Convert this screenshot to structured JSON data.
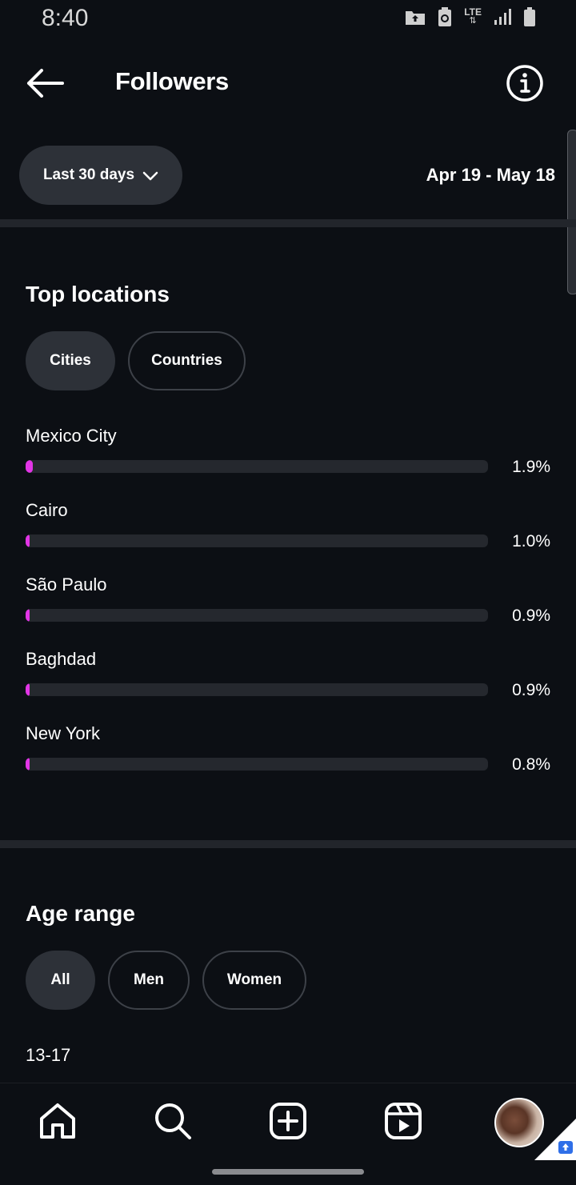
{
  "status_bar": {
    "time": "8:40",
    "network_label": "LTE"
  },
  "header": {
    "title": "Followers",
    "back_icon": "arrow-left-icon",
    "info_icon": "info-icon"
  },
  "filter": {
    "range_label": "Last 30 days",
    "date_range": "Apr 19 - May 18"
  },
  "top_locations": {
    "title": "Top locations",
    "tabs": [
      {
        "label": "Cities",
        "active": true
      },
      {
        "label": "Countries",
        "active": false
      }
    ],
    "items": [
      {
        "name": "Mexico City",
        "percent_label": "1.9%",
        "value": 1.9
      },
      {
        "name": "Cairo",
        "percent_label": "1.0%",
        "value": 1.0
      },
      {
        "name": "São Paulo",
        "percent_label": "0.9%",
        "value": 0.9
      },
      {
        "name": "Baghdad",
        "percent_label": "0.9%",
        "value": 0.9
      },
      {
        "name": "New York",
        "percent_label": "0.8%",
        "value": 0.8
      }
    ]
  },
  "age_range": {
    "title": "Age range",
    "tabs": [
      {
        "label": "All",
        "active": true
      },
      {
        "label": "Men",
        "active": false
      },
      {
        "label": "Women",
        "active": false
      }
    ],
    "first_bucket": "13-17"
  },
  "bottom_nav": {
    "items": [
      "home-icon",
      "search-icon",
      "create-icon",
      "reels-icon",
      "profile-avatar"
    ]
  },
  "colors": {
    "background": "#0c0f14",
    "bar_fill": "#e235e6",
    "bar_track": "#25282e",
    "pill_active": "#2d3138"
  }
}
